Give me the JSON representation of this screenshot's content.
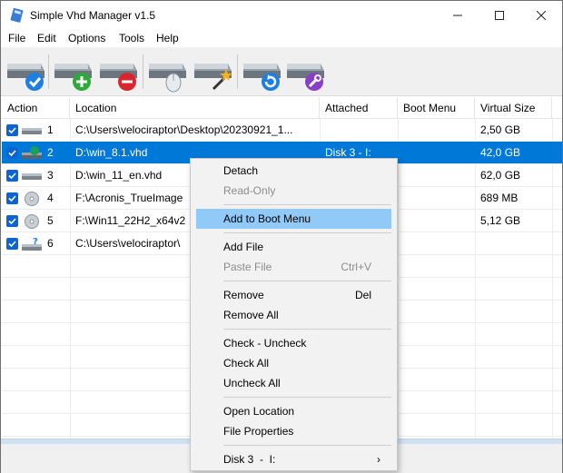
{
  "window": {
    "title": "Simple Vhd Manager v1.5"
  },
  "menubar": [
    "File",
    "Edit",
    "Options",
    "Tools",
    "Help"
  ],
  "toolbar": {
    "buttons": [
      {
        "name": "check-drives-button",
        "icon": "drive-check-icon",
        "badge": "#1f7fe0"
      },
      {
        "name": "add-vhd-button",
        "icon": "drive-add-icon",
        "badge": "#2eaa3a"
      },
      {
        "name": "remove-vhd-button",
        "icon": "drive-remove-icon",
        "badge": "#d9262e"
      },
      {
        "name": "mount-drive-button",
        "icon": "drive-mouse-icon",
        "badge": "#9aa4ae"
      },
      {
        "name": "create-vhd-button",
        "icon": "drive-wand-icon",
        "badge": "#f2b21c"
      },
      {
        "name": "refresh-button",
        "icon": "drive-refresh-icon",
        "badge": "#1f7fe0"
      },
      {
        "name": "tools-button",
        "icon": "drive-tools-icon",
        "badge": "#8a3fc7"
      }
    ]
  },
  "table": {
    "headers": [
      "Action",
      "Location",
      "Attached",
      "Boot Menu",
      "Virtual Size"
    ],
    "rows": [
      {
        "num": "1",
        "location": "C:\\Users\\velociraptor\\Desktop\\20230921_1...",
        "attached": "",
        "boot": "",
        "size": "2,50 GB",
        "icon": "hard-drive-icon"
      },
      {
        "num": "2",
        "location": "D:\\win_8.1.vhd",
        "attached": "Disk 3  -  I:",
        "boot": "",
        "size": "42,0 GB",
        "icon": "attached-drive-icon"
      },
      {
        "num": "3",
        "location": "D:\\win_11_en.vhd",
        "attached": "",
        "boot": "",
        "size": "62,0 GB",
        "icon": "hard-drive-icon"
      },
      {
        "num": "4",
        "location": "F:\\Acronis_TrueImage",
        "attached": "",
        "boot": "",
        "size": "689 MB",
        "icon": "disc-icon"
      },
      {
        "num": "5",
        "location": "F:\\Win11_22H2_x64v2",
        "attached": "",
        "boot": "",
        "size": "5,12 GB",
        "icon": "disc-icon"
      },
      {
        "num": "6",
        "location": "C:\\Users\\velociraptor\\",
        "attached": "",
        "boot": "",
        "size": "",
        "icon": "missing-drive-icon"
      }
    ]
  },
  "context_menu": {
    "detach": "Detach",
    "read_only": "Read-Only",
    "add_boot": "Add to Boot Menu",
    "add_file": "Add File",
    "paste_file": "Paste File",
    "paste_shortcut": "Ctrl+V",
    "remove": "Remove",
    "remove_shortcut": "Del",
    "remove_all": "Remove All",
    "check_uncheck": "Check - Uncheck",
    "check_all": "Check All",
    "uncheck_all": "Uncheck All",
    "open_location": "Open Location",
    "file_properties": "File Properties",
    "disk": "Disk 3  -  I:",
    "submenu_arrow": "›"
  },
  "colors": {
    "accent": "#0078d7",
    "hover": "#91c9f7"
  }
}
